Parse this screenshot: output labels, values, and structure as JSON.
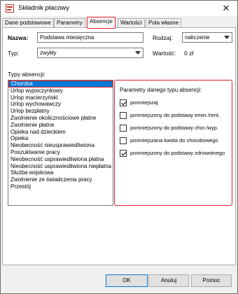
{
  "window": {
    "title": "Składnik płacowy",
    "close_glyph": "✕"
  },
  "tabs": [
    {
      "label": "Dane podstawowe"
    },
    {
      "label": "Parametry"
    },
    {
      "label": "Absencje"
    },
    {
      "label": "Wartości"
    },
    {
      "label": "Pola własne"
    }
  ],
  "active_tab": "Absencje",
  "form": {
    "nazwa_label": "Nazwa:",
    "nazwa_value": "Podstawa miesięczna",
    "rodzaj_label": "Rodzaj:",
    "rodzaj_value": "naliczenie",
    "typ_label": "Typ:",
    "typ_value": "zwykły",
    "wartosc_label": "Wartość:",
    "wartosc_value": "0 zł"
  },
  "absence_types": {
    "label": "Typy absencji:",
    "selected": "Choroba",
    "items": [
      "Choroba",
      "Urlop wypoczynkowy",
      "Urlop macierzyński",
      "Urlop wychowawczy",
      "Urlop bezpłatny",
      "Zwolnienie okolicznościowe płatne",
      "Zwolnienie płatne",
      "Opieka nad dzieckiem",
      "Opieka",
      "Nieobecność nieusprawiedliwiona",
      "Poszukiwanie pracy",
      "Nieobecność usprawiedliwiona płatna",
      "Nieobecność usprawiedliwiona niepłatna",
      "Służba wojskowa",
      "Zwolnienie ze świadczenia pracy",
      "Przestój"
    ]
  },
  "parameters": {
    "title": "Parametry danego typu absencji:",
    "options": [
      {
        "label": "pomniejszaj",
        "checked": true
      },
      {
        "label": "pomniejszony do podstawy emer./rent.",
        "checked": false
      },
      {
        "label": "pomniejszony do podstawy chor./wyp.",
        "checked": false
      },
      {
        "label": "pomniejszana kwota do chorobowego",
        "checked": false
      },
      {
        "label": "pomniejszony do podstawy zdrowotnego",
        "checked": true
      }
    ]
  },
  "buttons": {
    "ok": "OK",
    "cancel": "Anuluj",
    "help": "Pomoc"
  },
  "colors": {
    "highlight_border": "#e0202a",
    "selection": "#0078d7"
  },
  "icons": {
    "app": "payroll-component-icon",
    "close": "close-icon",
    "dropdown": "chevron-down-icon",
    "checkbox": "checkbox-icon"
  }
}
